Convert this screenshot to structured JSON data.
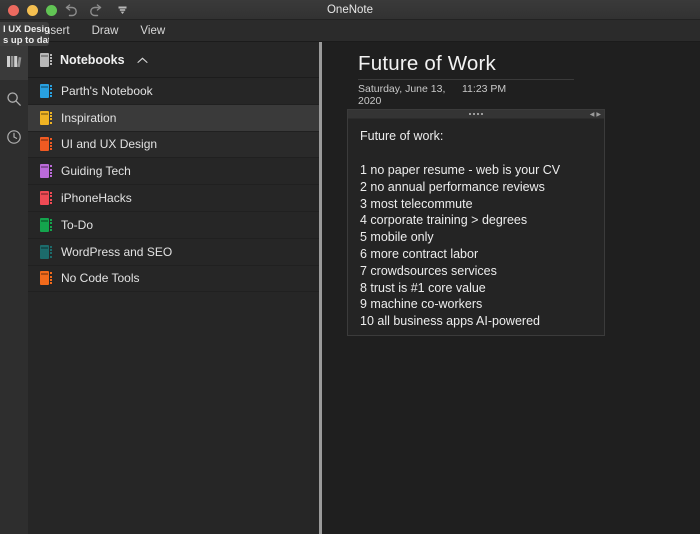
{
  "window": {
    "title": "OneNote",
    "traffic_lights": [
      {
        "name": "close",
        "color": "#ec6a5f"
      },
      {
        "name": "minimize",
        "color": "#f4bf50"
      },
      {
        "name": "zoom",
        "color": "#61c454"
      }
    ],
    "toolbar": [
      {
        "name": "undo",
        "icon": "undo-arrow-icon"
      },
      {
        "name": "redo",
        "icon": "redo-arrow-icon"
      },
      {
        "name": "customize",
        "icon": "customize-toolbar-icon"
      }
    ]
  },
  "menubar": {
    "items": [
      {
        "label": "nsert"
      },
      {
        "label": "Draw"
      },
      {
        "label": "View"
      }
    ]
  },
  "tooltip": {
    "line1": "l UX Design",
    "line2": "s up to date"
  },
  "rail": {
    "items": [
      {
        "name": "notebooks",
        "icon": "books-icon",
        "active": true
      },
      {
        "name": "search",
        "icon": "search-icon",
        "active": false
      },
      {
        "name": "recent",
        "icon": "clock-icon",
        "active": false
      }
    ]
  },
  "sidebar": {
    "header": {
      "label": "Notebooks",
      "icon": "notebook-icon",
      "chevron": "chevron-up-icon"
    },
    "notebooks": [
      {
        "label": "Parth's Notebook",
        "color": "#28a0e0",
        "selected": false,
        "alt": false
      },
      {
        "label": "Inspiration",
        "color": "#f0b323",
        "selected": true,
        "alt": false
      },
      {
        "label": "UI and UX Design",
        "color": "#f05a22",
        "selected": false,
        "alt": true
      },
      {
        "label": "Guiding Tech",
        "color": "#bb6bd9",
        "selected": false,
        "alt": false
      },
      {
        "label": "iPhoneHacks",
        "color": "#ef4a54",
        "selected": false,
        "alt": false
      },
      {
        "label": "To-Do",
        "color": "#14a44d",
        "selected": false,
        "alt": false
      },
      {
        "label": "WordPress and SEO",
        "color": "#1c6b6b",
        "selected": false,
        "alt": false
      },
      {
        "label": "No Code Tools",
        "color": "#f26a1b",
        "selected": false,
        "alt": false
      }
    ]
  },
  "page": {
    "title": "Future of Work",
    "date": "Saturday, June 13, 2020",
    "time": "11:23 PM"
  },
  "note": {
    "heading": "Future of work:",
    "items": [
      "1 no paper resume - web is your CV",
      "2 no annual performance reviews",
      "3 most telecommute",
      "4 corporate training > degrees",
      "5 mobile only",
      "6 more contract labor",
      "7 crowdsources services",
      "8 trust is #1 core value",
      "9 machine co-workers",
      "10 all business apps AI-powered"
    ]
  }
}
